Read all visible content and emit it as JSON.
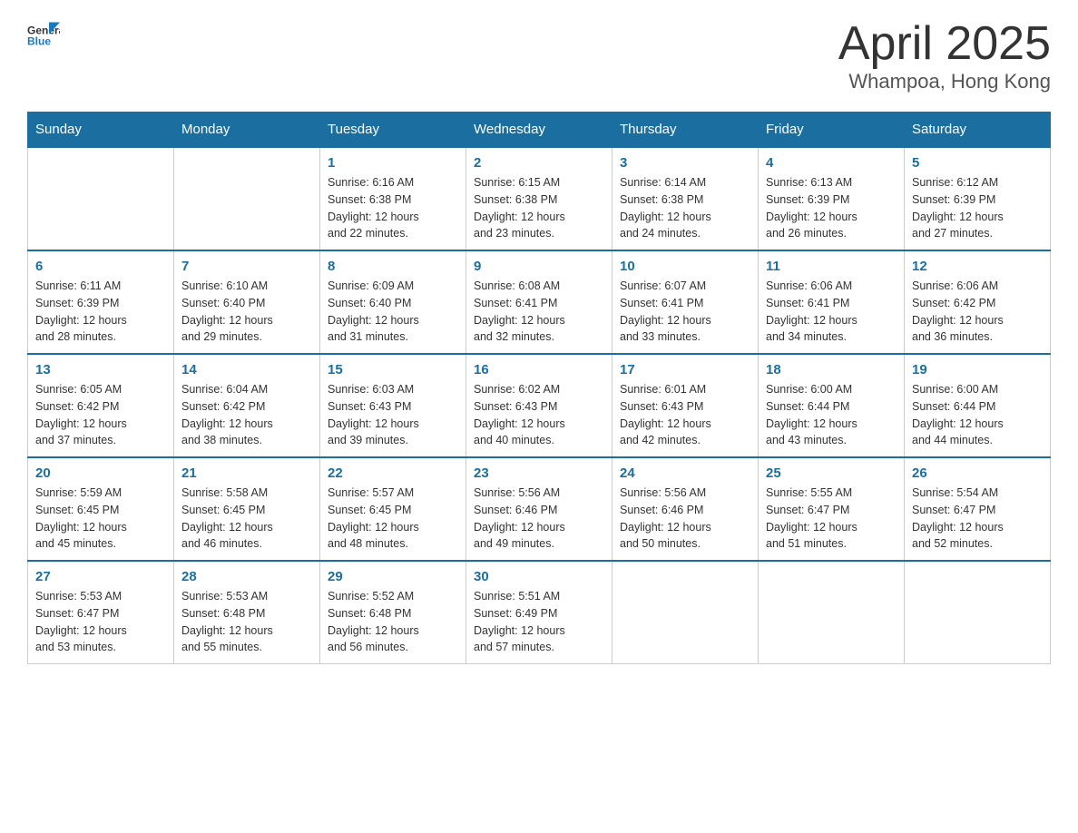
{
  "header": {
    "logo_general": "General",
    "logo_blue": "Blue",
    "month_title": "April 2025",
    "location": "Whampoa, Hong Kong"
  },
  "weekdays": [
    "Sunday",
    "Monday",
    "Tuesday",
    "Wednesday",
    "Thursday",
    "Friday",
    "Saturday"
  ],
  "weeks": [
    [
      {
        "day": "",
        "info": ""
      },
      {
        "day": "",
        "info": ""
      },
      {
        "day": "1",
        "info": "Sunrise: 6:16 AM\nSunset: 6:38 PM\nDaylight: 12 hours\nand 22 minutes."
      },
      {
        "day": "2",
        "info": "Sunrise: 6:15 AM\nSunset: 6:38 PM\nDaylight: 12 hours\nand 23 minutes."
      },
      {
        "day": "3",
        "info": "Sunrise: 6:14 AM\nSunset: 6:38 PM\nDaylight: 12 hours\nand 24 minutes."
      },
      {
        "day": "4",
        "info": "Sunrise: 6:13 AM\nSunset: 6:39 PM\nDaylight: 12 hours\nand 26 minutes."
      },
      {
        "day": "5",
        "info": "Sunrise: 6:12 AM\nSunset: 6:39 PM\nDaylight: 12 hours\nand 27 minutes."
      }
    ],
    [
      {
        "day": "6",
        "info": "Sunrise: 6:11 AM\nSunset: 6:39 PM\nDaylight: 12 hours\nand 28 minutes."
      },
      {
        "day": "7",
        "info": "Sunrise: 6:10 AM\nSunset: 6:40 PM\nDaylight: 12 hours\nand 29 minutes."
      },
      {
        "day": "8",
        "info": "Sunrise: 6:09 AM\nSunset: 6:40 PM\nDaylight: 12 hours\nand 31 minutes."
      },
      {
        "day": "9",
        "info": "Sunrise: 6:08 AM\nSunset: 6:41 PM\nDaylight: 12 hours\nand 32 minutes."
      },
      {
        "day": "10",
        "info": "Sunrise: 6:07 AM\nSunset: 6:41 PM\nDaylight: 12 hours\nand 33 minutes."
      },
      {
        "day": "11",
        "info": "Sunrise: 6:06 AM\nSunset: 6:41 PM\nDaylight: 12 hours\nand 34 minutes."
      },
      {
        "day": "12",
        "info": "Sunrise: 6:06 AM\nSunset: 6:42 PM\nDaylight: 12 hours\nand 36 minutes."
      }
    ],
    [
      {
        "day": "13",
        "info": "Sunrise: 6:05 AM\nSunset: 6:42 PM\nDaylight: 12 hours\nand 37 minutes."
      },
      {
        "day": "14",
        "info": "Sunrise: 6:04 AM\nSunset: 6:42 PM\nDaylight: 12 hours\nand 38 minutes."
      },
      {
        "day": "15",
        "info": "Sunrise: 6:03 AM\nSunset: 6:43 PM\nDaylight: 12 hours\nand 39 minutes."
      },
      {
        "day": "16",
        "info": "Sunrise: 6:02 AM\nSunset: 6:43 PM\nDaylight: 12 hours\nand 40 minutes."
      },
      {
        "day": "17",
        "info": "Sunrise: 6:01 AM\nSunset: 6:43 PM\nDaylight: 12 hours\nand 42 minutes."
      },
      {
        "day": "18",
        "info": "Sunrise: 6:00 AM\nSunset: 6:44 PM\nDaylight: 12 hours\nand 43 minutes."
      },
      {
        "day": "19",
        "info": "Sunrise: 6:00 AM\nSunset: 6:44 PM\nDaylight: 12 hours\nand 44 minutes."
      }
    ],
    [
      {
        "day": "20",
        "info": "Sunrise: 5:59 AM\nSunset: 6:45 PM\nDaylight: 12 hours\nand 45 minutes."
      },
      {
        "day": "21",
        "info": "Sunrise: 5:58 AM\nSunset: 6:45 PM\nDaylight: 12 hours\nand 46 minutes."
      },
      {
        "day": "22",
        "info": "Sunrise: 5:57 AM\nSunset: 6:45 PM\nDaylight: 12 hours\nand 48 minutes."
      },
      {
        "day": "23",
        "info": "Sunrise: 5:56 AM\nSunset: 6:46 PM\nDaylight: 12 hours\nand 49 minutes."
      },
      {
        "day": "24",
        "info": "Sunrise: 5:56 AM\nSunset: 6:46 PM\nDaylight: 12 hours\nand 50 minutes."
      },
      {
        "day": "25",
        "info": "Sunrise: 5:55 AM\nSunset: 6:47 PM\nDaylight: 12 hours\nand 51 minutes."
      },
      {
        "day": "26",
        "info": "Sunrise: 5:54 AM\nSunset: 6:47 PM\nDaylight: 12 hours\nand 52 minutes."
      }
    ],
    [
      {
        "day": "27",
        "info": "Sunrise: 5:53 AM\nSunset: 6:47 PM\nDaylight: 12 hours\nand 53 minutes."
      },
      {
        "day": "28",
        "info": "Sunrise: 5:53 AM\nSunset: 6:48 PM\nDaylight: 12 hours\nand 55 minutes."
      },
      {
        "day": "29",
        "info": "Sunrise: 5:52 AM\nSunset: 6:48 PM\nDaylight: 12 hours\nand 56 minutes."
      },
      {
        "day": "30",
        "info": "Sunrise: 5:51 AM\nSunset: 6:49 PM\nDaylight: 12 hours\nand 57 minutes."
      },
      {
        "day": "",
        "info": ""
      },
      {
        "day": "",
        "info": ""
      },
      {
        "day": "",
        "info": ""
      }
    ]
  ]
}
